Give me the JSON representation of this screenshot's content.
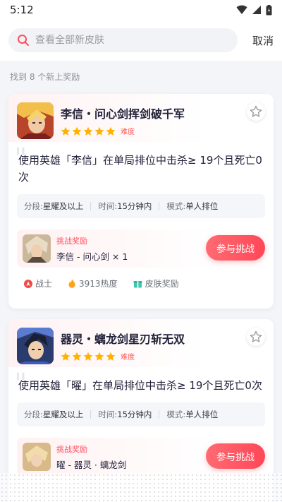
{
  "status": {
    "time": "5:12"
  },
  "search": {
    "placeholder": "查看全部新皮肤",
    "cancel_label": "取消"
  },
  "result_count": "找到 8 个新上奖励",
  "cards": [
    {
      "title": "李信・问心剑挥剑破千军",
      "stars": 5,
      "difficulty_label": "难度",
      "description": "使用英雄「李信」在单局排位中击杀≥ 19个且死亡0次",
      "conditions": {
        "rank_label": "分段:",
        "rank_value": "星耀及以上",
        "time_label": "时间:",
        "time_value": "15分钟内",
        "mode_label": "模式:",
        "mode_value": "单人排位"
      },
      "reward": {
        "label": "挑战奖励",
        "name": "李信 - 问心剑 × 1"
      },
      "join_label": "参与挑战",
      "tags": {
        "role": "战士",
        "heat": "3913热度",
        "type": "皮肤奖励"
      }
    },
    {
      "title": "器灵・螭龙剑星刃斩无双",
      "stars": 5,
      "difficulty_label": "难度",
      "description": "使用英雄「曜」在单局排位中击杀≥ 19个且死亡0次",
      "conditions": {
        "rank_label": "分段:",
        "rank_value": "星耀及以上",
        "time_label": "时间:",
        "time_value": "15分钟内",
        "mode_label": "模式:",
        "mode_value": "单人排位"
      },
      "reward": {
        "label": "挑战奖励",
        "name": "曜 - 器灵 · 螭龙剑"
      },
      "join_label": "参与挑战"
    }
  ],
  "colors": {
    "accent": "#ff4d5e",
    "star": "#ffb300",
    "background": "#f4f5f9"
  },
  "icons": [
    "search-icon",
    "wifi-icon",
    "signal-icon",
    "battery-icon",
    "star-outline-icon",
    "star-icon",
    "fighter-icon",
    "fire-icon",
    "gift-icon"
  ]
}
